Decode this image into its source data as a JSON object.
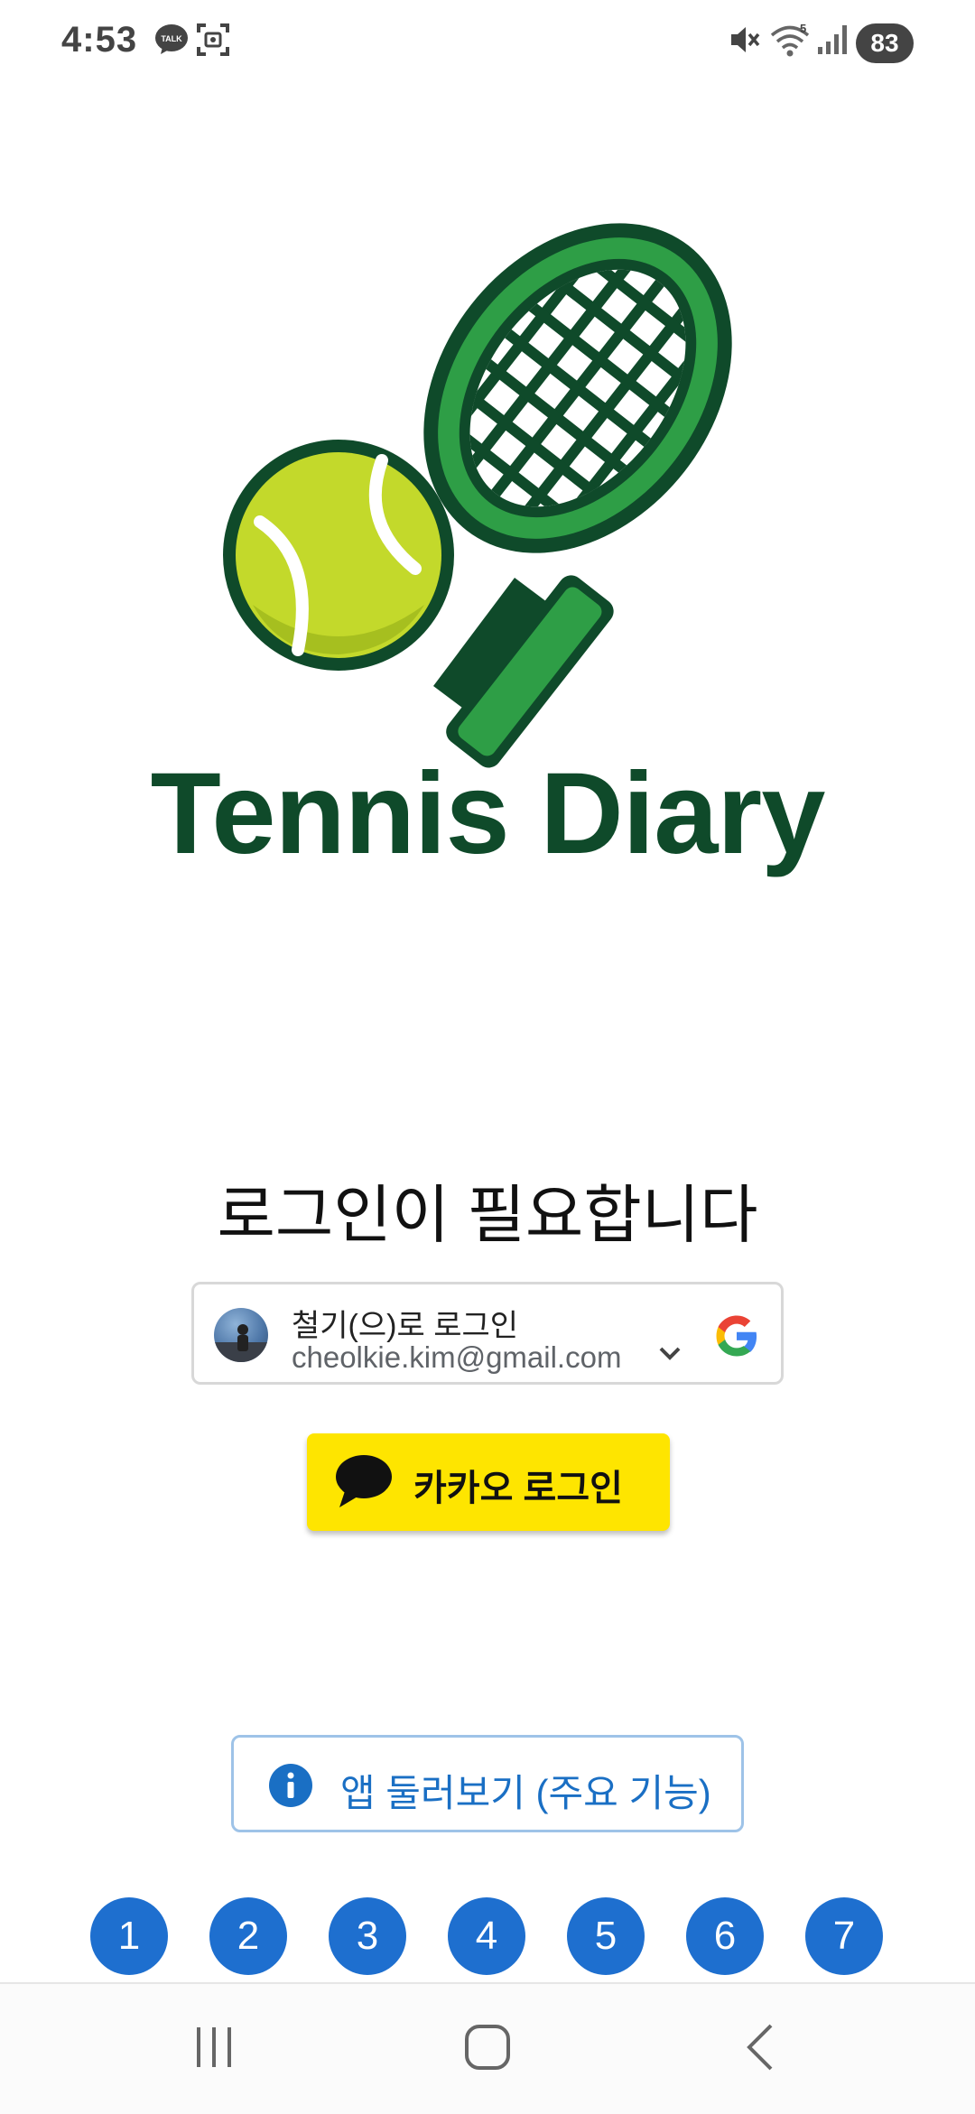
{
  "status_bar": {
    "time": "4:53",
    "battery": "83",
    "icons": [
      "kakaotalk-icon",
      "screenshot-icon",
      "mute-icon",
      "wifi-icon",
      "signal-icon"
    ]
  },
  "brand": {
    "name": "Tennis Diary",
    "colors": {
      "dark_green": "#0f4a2a",
      "green": "#2e9e46",
      "ball": "#c3d92b"
    }
  },
  "login": {
    "title": "로그인이 필요합니다",
    "google": {
      "line1": "철기(으)로 로그인",
      "email": "cheolkie.kim@gmail.com"
    },
    "kakao": {
      "label": "카카오 로그인",
      "color": "#FEE500"
    }
  },
  "tour": {
    "label": "앱 둘러보기 (주요 기능)",
    "color": "#1a6fc4"
  },
  "steps": [
    "1",
    "2",
    "3",
    "4",
    "5",
    "6",
    "7"
  ],
  "nav": {
    "buttons": [
      "recent-apps-icon",
      "home-icon",
      "back-icon"
    ]
  }
}
